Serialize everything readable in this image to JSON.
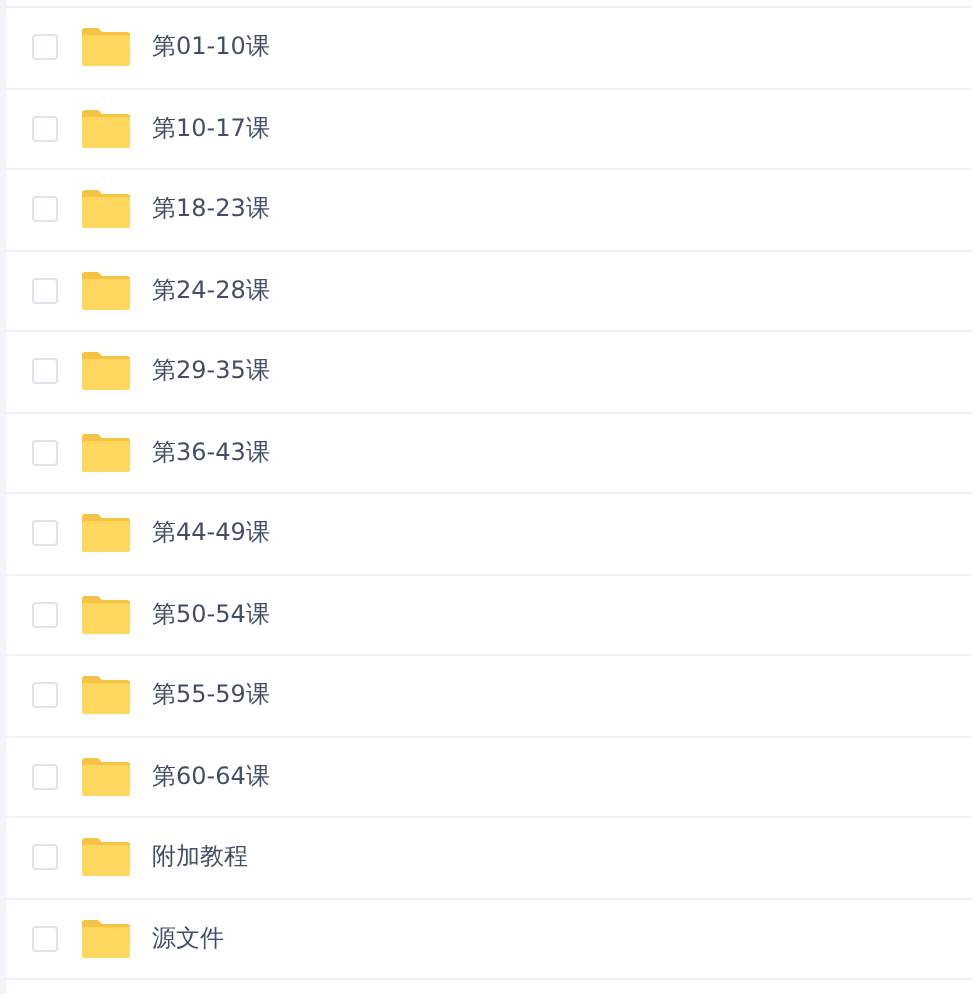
{
  "files": [
    {
      "name": "第01-10课",
      "checked": false
    },
    {
      "name": "第10-17课",
      "checked": false
    },
    {
      "name": "第18-23课",
      "checked": false
    },
    {
      "name": "第24-28课",
      "checked": false
    },
    {
      "name": "第29-35课",
      "checked": false
    },
    {
      "name": "第36-43课",
      "checked": false
    },
    {
      "name": "第44-49课",
      "checked": false
    },
    {
      "name": "第50-54课",
      "checked": false
    },
    {
      "name": "第55-59课",
      "checked": false
    },
    {
      "name": "第60-64课",
      "checked": false
    },
    {
      "name": "附加教程",
      "checked": false
    },
    {
      "name": "源文件",
      "checked": false
    }
  ]
}
